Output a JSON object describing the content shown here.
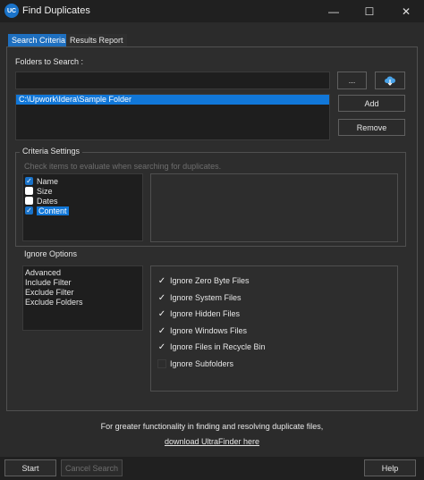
{
  "window": {
    "title": "Find Duplicates",
    "icon_text": "UC",
    "minimize": "—",
    "maximize": "☐",
    "close": "✕"
  },
  "tabs": [
    {
      "label": "Search Criteria",
      "active": true
    },
    {
      "label": "Results Report",
      "active": false
    }
  ],
  "folders": {
    "label": "Folders to Search :",
    "browse_label": "...",
    "list": [
      "C:\\Upwork\\Idera\\Sample Folder"
    ],
    "add_label": "Add",
    "remove_label": "Remove"
  },
  "criteria": {
    "title": "Criteria Settings",
    "hint": "Check items to evaluate when searching for duplicates.",
    "items": [
      {
        "label": "Name",
        "checked": true
      },
      {
        "label": "Size",
        "checked": false
      },
      {
        "label": "Dates",
        "checked": false
      },
      {
        "label": "Content",
        "checked": true
      }
    ]
  },
  "ignore": {
    "title": "Ignore Options",
    "list": [
      "Advanced",
      "Include Filter",
      "Exclude Filter",
      "Exclude Folders"
    ],
    "options": [
      {
        "label": "Ignore Zero Byte Files",
        "checked": true
      },
      {
        "label": "Ignore System Files",
        "checked": true
      },
      {
        "label": "Ignore Hidden Files",
        "checked": true
      },
      {
        "label": "Ignore Windows Files",
        "checked": true
      },
      {
        "label": "Ignore Files in Recycle Bin",
        "checked": true
      },
      {
        "label": "Ignore Subfolders",
        "checked": false
      }
    ]
  },
  "footer": {
    "text": "For greater functionality in finding and resolving duplicate files,",
    "link": "download UltraFinder here"
  },
  "buttons": {
    "start": "Start",
    "cancel": "Cancel Search",
    "help": "Help"
  },
  "colors": {
    "accent": "#1a73c9",
    "selection": "#1177d8",
    "background": "#2b2b2b"
  }
}
